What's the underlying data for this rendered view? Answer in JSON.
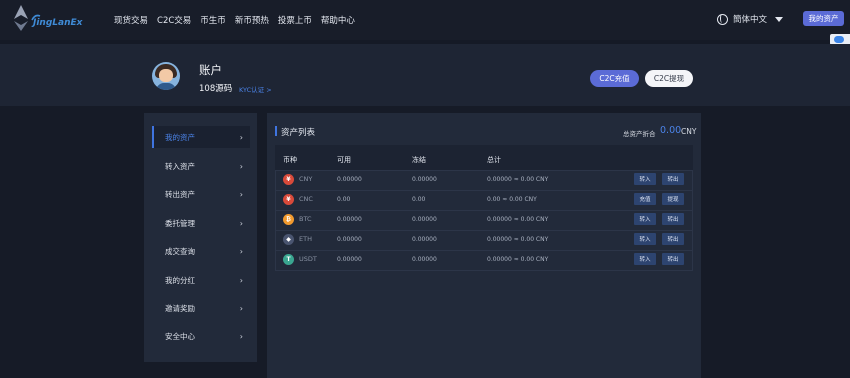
{
  "brand": {
    "name": "JingLanEx"
  },
  "nav": {
    "items": [
      "现货交易",
      "C2C交易",
      "币生币",
      "新币预热",
      "投票上币",
      "帮助中心"
    ],
    "language": "簡体中文",
    "my_assets": "我的资产"
  },
  "account": {
    "title": "账户",
    "name": "108源码",
    "kyc": "KYC认证 >",
    "c2c_deposit": "C2C充值",
    "c2c_withdraw": "C2C提现"
  },
  "sidebar": {
    "items": [
      {
        "label": "我的资产",
        "active": true
      },
      {
        "label": "转入资产"
      },
      {
        "label": "转出资产"
      },
      {
        "label": "委托管理"
      },
      {
        "label": "成交查询"
      },
      {
        "label": "我的分红"
      },
      {
        "label": "邀请奖励"
      },
      {
        "label": "安全中心"
      }
    ],
    "chevron": "›"
  },
  "assets": {
    "title": "资产列表",
    "total_label": "总资产折合",
    "total_value": "0.00",
    "total_unit": "CNY",
    "columns": [
      "币种",
      "可用",
      "冻结",
      "总计"
    ],
    "rows": [
      {
        "icon": "¥",
        "icon_color": "#d84a3a",
        "symbol": "CNY",
        "available": "0.00000",
        "frozen": "0.00000",
        "total": "0.00000 ≈ 0.00 CNY",
        "actions": [
          "转入",
          "转出"
        ]
      },
      {
        "icon": "¥",
        "icon_color": "#d84a3a",
        "symbol": "CNC",
        "available": "0.00",
        "frozen": "0.00",
        "total": "0.00 ≈ 0.00 CNY",
        "actions": [
          "充值",
          "提现"
        ]
      },
      {
        "icon": "₿",
        "icon_color": "#f29a2e",
        "symbol": "BTC",
        "available": "0.00000",
        "frozen": "0.00000",
        "total": "0.00000 ≈ 0.00 CNY",
        "actions": [
          "转入",
          "转出"
        ]
      },
      {
        "icon": "◆",
        "icon_color": "#4a5570",
        "symbol": "ETH",
        "available": "0.00000",
        "frozen": "0.00000",
        "total": "0.00000 ≈ 0.00 CNY",
        "actions": [
          "转入",
          "转出"
        ]
      },
      {
        "icon": "T",
        "icon_color": "#3aa690",
        "symbol": "USDT",
        "available": "0.00000",
        "frozen": "0.00000",
        "total": "0.00000 ≈ 0.00 CNY",
        "actions": [
          "转入",
          "转出"
        ]
      }
    ]
  },
  "colors": {
    "accent": "#5b6bd6",
    "link": "#4b83e8",
    "background": "#151a26",
    "panel": "#222a3a"
  }
}
